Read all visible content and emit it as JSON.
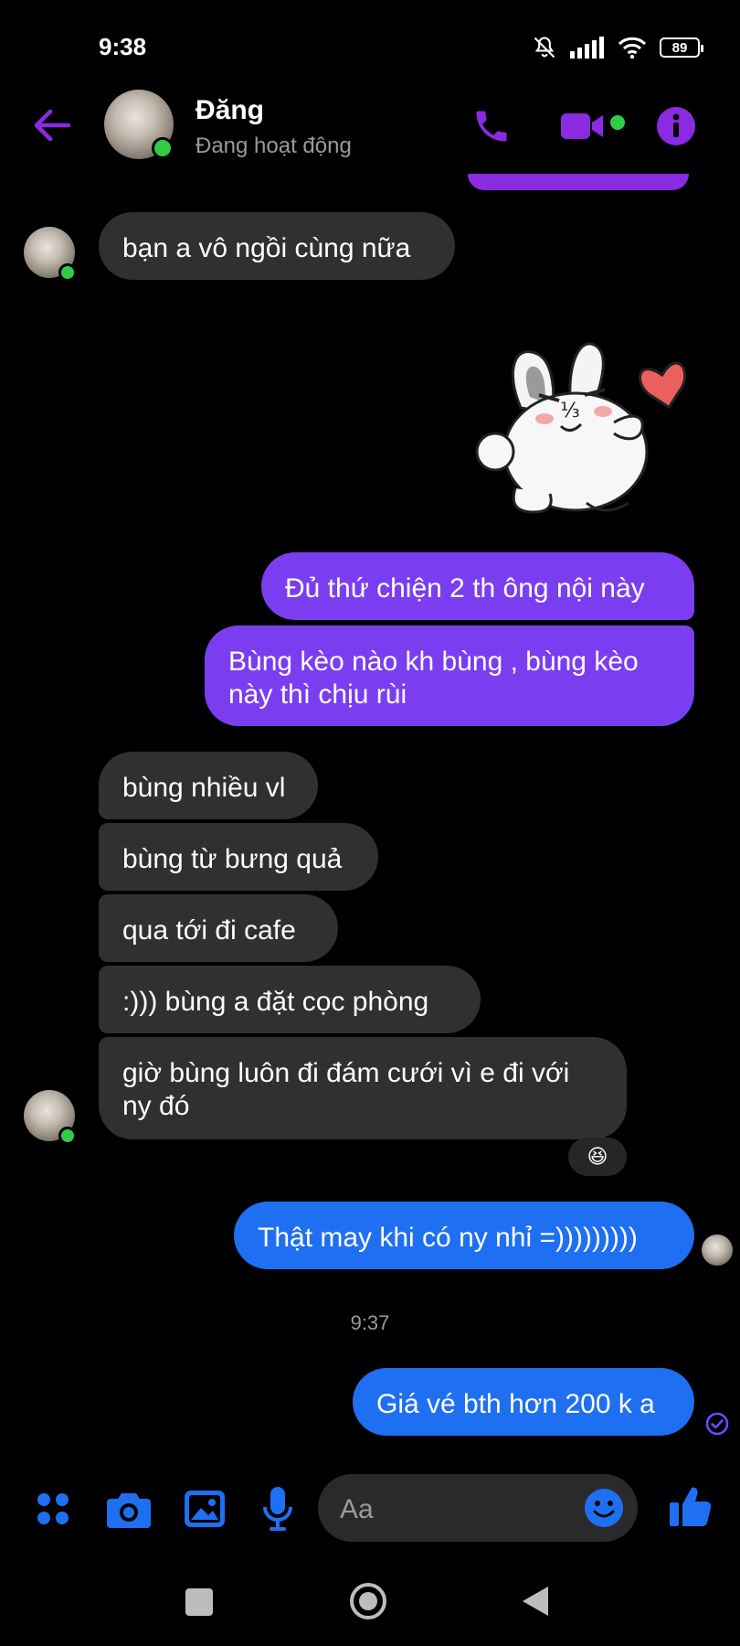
{
  "status_bar": {
    "time": "9:38",
    "battery": "89",
    "icons": [
      "mute-bell-icon",
      "signal-icon",
      "wifi-icon",
      "battery-icon"
    ]
  },
  "header": {
    "contact_name": "Đăng",
    "contact_status": "Đang hoạt động",
    "accent_color": "#8a2be2",
    "icons": [
      "back-arrow-icon",
      "phone-icon",
      "video-icon",
      "info-icon"
    ]
  },
  "messages": {
    "m1": "bạn a vô ngồi cùng nữa",
    "m2": "Đủ thứ chiện 2 th ông nội này",
    "m3": "Bùng kèo nào kh bùng , bùng kèo này thì chịu rùi",
    "m4": "bùng nhiều vl",
    "m5": "bùng từ bưng quả",
    "m6": "qua tới đi cafe",
    "m7": ":))) bùng a đặt cọc phòng",
    "m8": "giờ bùng luôn đi đám cưới vì e đi với ny đó",
    "m9": "Thật may khi có ny nhỉ =)))))))))",
    "m10": "Giá vé bth hơn 200 k a"
  },
  "reaction": "😆",
  "timestamp": "9:37",
  "composer": {
    "placeholder": "Aa",
    "icons": [
      "menu-dots-icon",
      "camera-icon",
      "gallery-icon",
      "mic-icon",
      "emoji-icon",
      "thumbs-up-icon"
    ],
    "accent_color": "#1f6ff2"
  },
  "nav_bar": {
    "buttons": [
      "recents-button",
      "home-button",
      "back-button"
    ]
  },
  "colors": {
    "incoming_bubble": "#303030",
    "outgoing_purple": "#7a3ef0",
    "outgoing_blue": "#1f6ff2",
    "online": "#31cc46"
  }
}
